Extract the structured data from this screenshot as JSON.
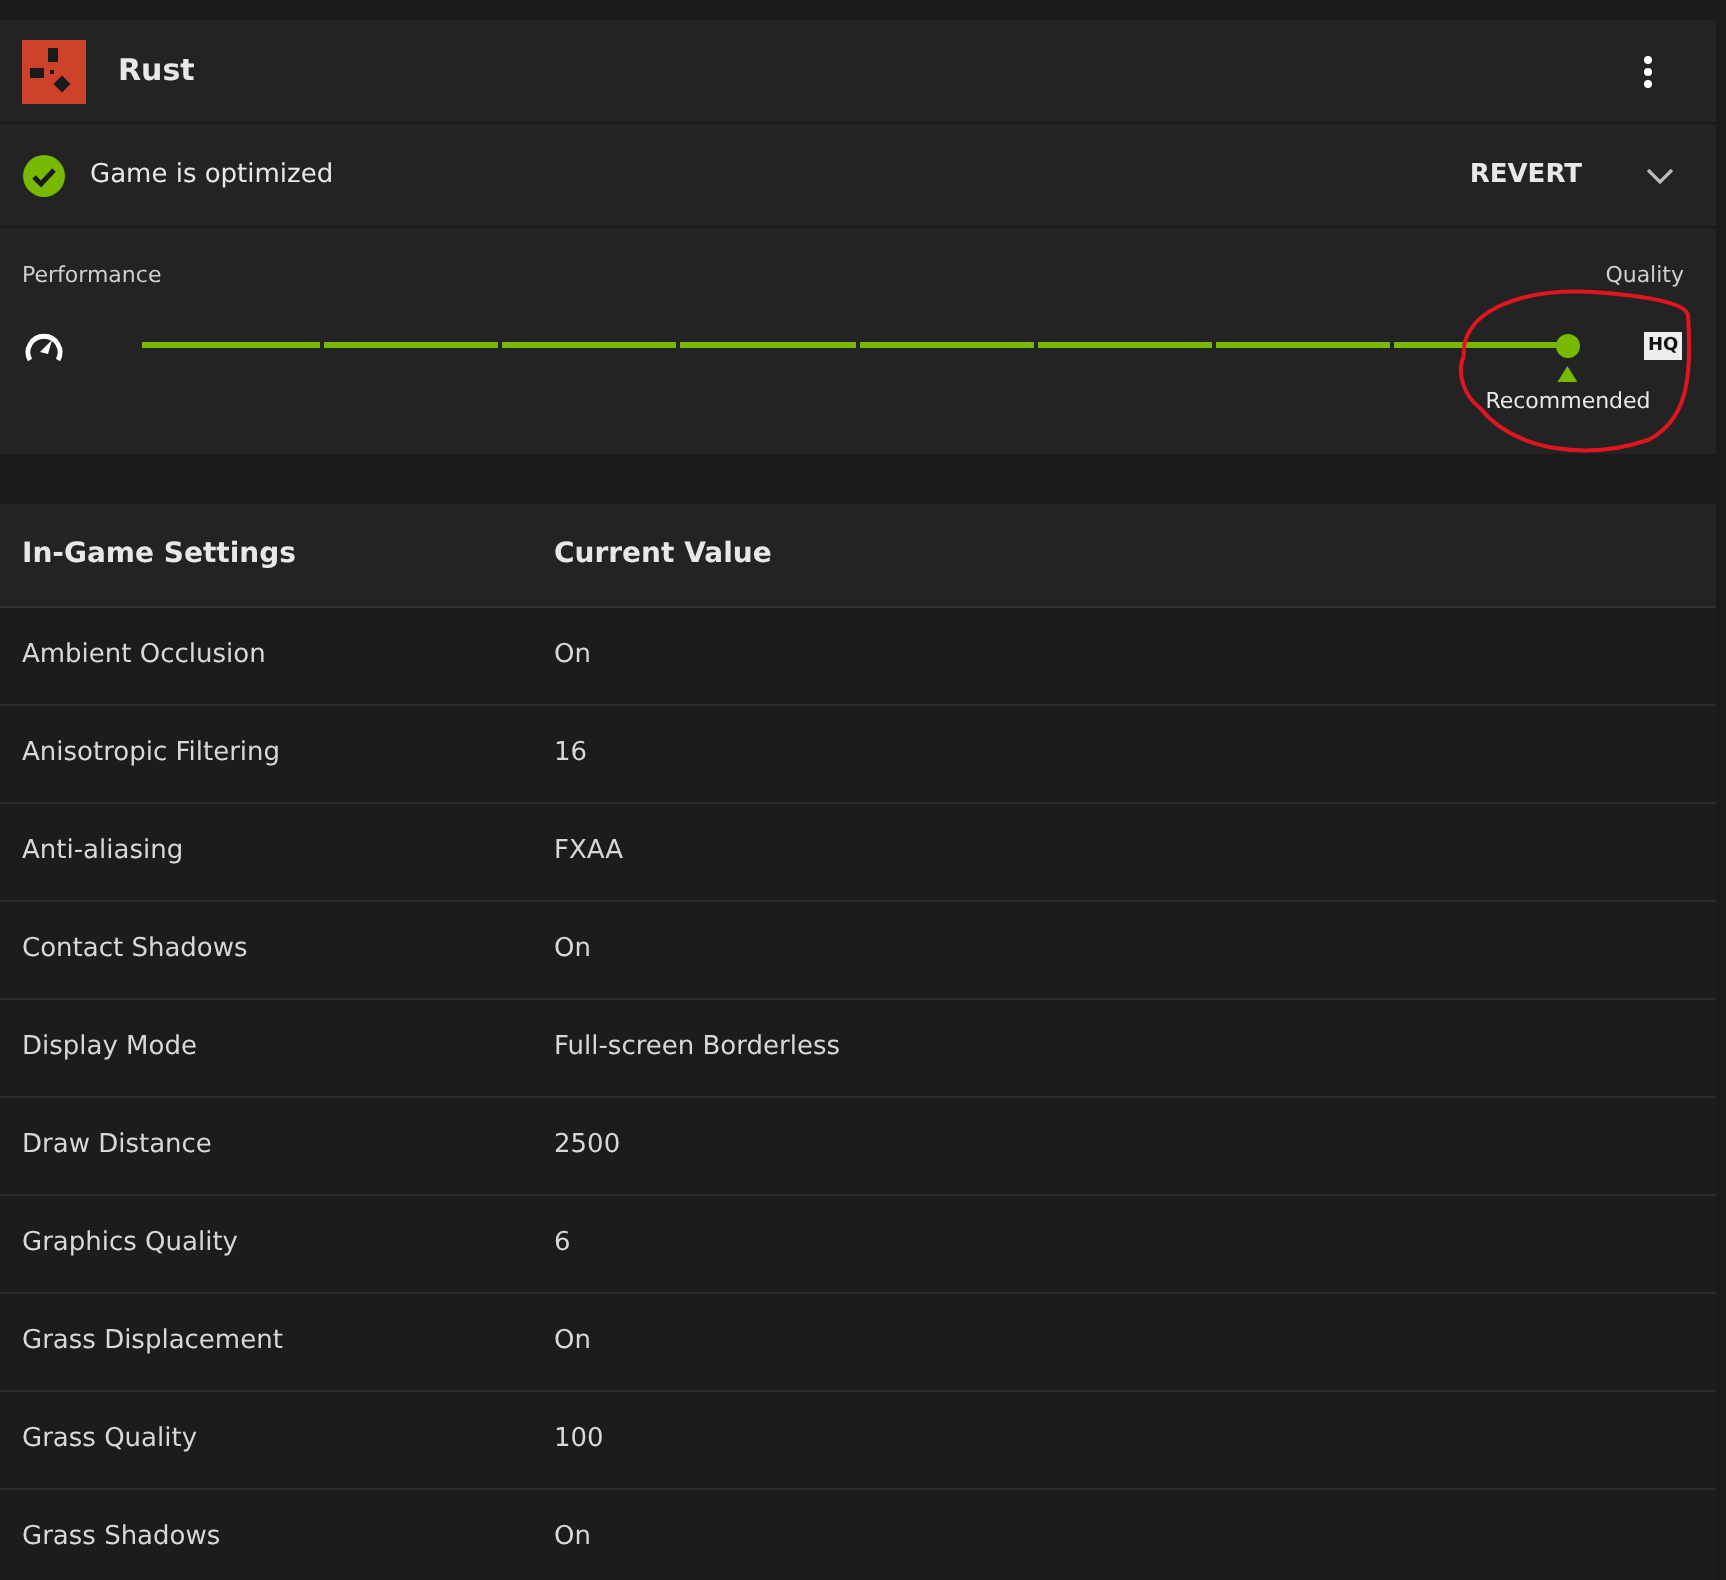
{
  "game": {
    "title": "Rust"
  },
  "status": {
    "text": "Game is optimized",
    "optimized": true,
    "action": "REVERT",
    "expanded": false
  },
  "slider": {
    "left_label": "Performance",
    "right_label": "Quality",
    "level": 1,
    "marker_label": "Recommended",
    "end_badge": "HQ"
  },
  "table": {
    "columns": [
      "In-Game Settings",
      "Current Value"
    ],
    "rows": [
      [
        "Ambient Occlusion",
        "On"
      ],
      [
        "Anisotropic Filtering",
        "16"
      ],
      [
        "Anti-aliasing",
        "FXAA"
      ],
      [
        "Contact Shadows",
        "On"
      ],
      [
        "Display Mode",
        "Full-screen Borderless"
      ],
      [
        "Draw Distance",
        "2500"
      ],
      [
        "Graphics Quality",
        "6"
      ],
      [
        "Grass Displacement",
        "On"
      ],
      [
        "Grass Quality",
        "100"
      ],
      [
        "Grass Shadows",
        "On"
      ]
    ]
  }
}
